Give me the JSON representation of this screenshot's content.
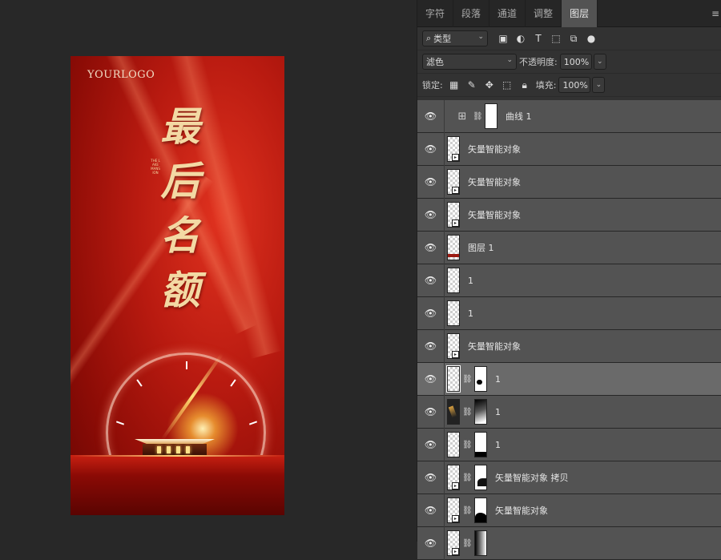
{
  "canvas": {
    "logo": "YOURLOGO",
    "title_chars": [
      "最",
      "后",
      "名",
      "额"
    ],
    "vertical_tag": "THE LAKE MANSION"
  },
  "panel": {
    "tabs": [
      {
        "label": "字符",
        "active": false
      },
      {
        "label": "段落",
        "active": false
      },
      {
        "label": "通道",
        "active": false
      },
      {
        "label": "调整",
        "active": false
      },
      {
        "label": "图层",
        "active": true
      }
    ],
    "filter_label": "类型",
    "blend_mode": "滤色",
    "opacity_label": "不透明度:",
    "opacity_value": "100%",
    "lock_label": "锁定:",
    "fill_label": "填充:",
    "fill_value": "100%"
  },
  "layers": [
    {
      "name": "曲线 1",
      "type": "adjustment"
    },
    {
      "name": "矢量智能对象",
      "type": "smart"
    },
    {
      "name": "矢量智能对象",
      "type": "smart"
    },
    {
      "name": "矢量智能对象",
      "type": "smart"
    },
    {
      "name": "图层 1",
      "type": "red"
    },
    {
      "name": "1",
      "type": "plain"
    },
    {
      "name": "1",
      "type": "plain"
    },
    {
      "name": "矢量智能对象",
      "type": "smart"
    },
    {
      "name": "1",
      "type": "masked",
      "mask": "m1",
      "selected": true
    },
    {
      "name": "1",
      "type": "masked-dark",
      "mask": "m2"
    },
    {
      "name": "1",
      "type": "masked",
      "mask": "m3"
    },
    {
      "name": "矢量智能对象 拷贝",
      "type": "smart-masked",
      "mask": "m4"
    },
    {
      "name": "矢量智能对象",
      "type": "smart-masked",
      "mask": "m5"
    },
    {
      "name": "",
      "type": "smart-masked",
      "mask": "m6"
    }
  ],
  "colors": {
    "accent_red": "#b81a10",
    "panel_bg": "#535353",
    "selected_bg": "#6a6a6a",
    "title_gold": "#f3d9a4"
  }
}
